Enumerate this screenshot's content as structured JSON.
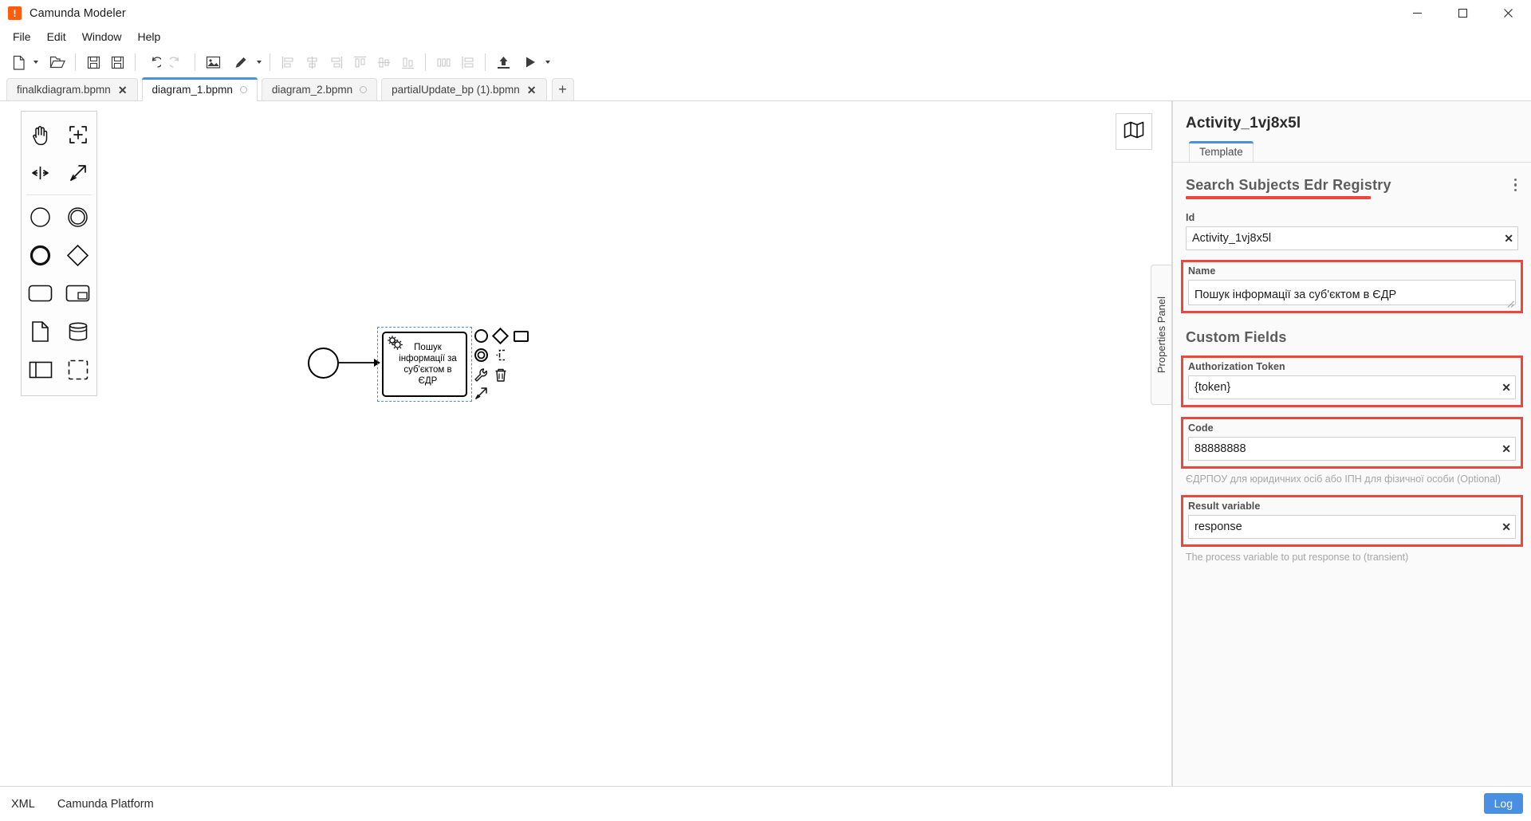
{
  "window": {
    "title": "Camunda Modeler",
    "app_icon": "camunda-icon",
    "minimize_label": "Minimize",
    "maximize_label": "Maximize",
    "close_label": "Close"
  },
  "menu": {
    "items": [
      {
        "label": "File"
      },
      {
        "label": "Edit"
      },
      {
        "label": "Window"
      },
      {
        "label": "Help"
      }
    ]
  },
  "toolbar": {
    "buttons": [
      {
        "name": "new-diagram",
        "icon": "file-icon",
        "disabled": false
      },
      {
        "name": "open-diagram",
        "icon": "folder-open-icon",
        "disabled": false
      },
      {
        "name": "save-diagram",
        "icon": "save-icon",
        "disabled": false
      },
      {
        "name": "save-as-diagram",
        "icon": "save-as-icon",
        "disabled": false
      },
      {
        "name": "undo",
        "icon": "undo-icon",
        "disabled": false
      },
      {
        "name": "redo",
        "icon": "redo-icon",
        "disabled": true
      },
      {
        "name": "export-image",
        "icon": "image-icon",
        "disabled": false
      },
      {
        "name": "set-color",
        "icon": "paintbrush-icon",
        "disabled": false
      },
      {
        "name": "align-left",
        "icon": "align-left-icon",
        "disabled": true
      },
      {
        "name": "align-center",
        "icon": "align-center-icon",
        "disabled": true
      },
      {
        "name": "align-right",
        "icon": "align-right-icon",
        "disabled": true
      },
      {
        "name": "align-top",
        "icon": "align-top-icon",
        "disabled": true
      },
      {
        "name": "align-middle",
        "icon": "align-middle-icon",
        "disabled": true
      },
      {
        "name": "align-bottom",
        "icon": "align-bottom-icon",
        "disabled": true
      },
      {
        "name": "distribute-horizontally",
        "icon": "distribute-horizontal-icon",
        "disabled": true
      },
      {
        "name": "distribute-vertically",
        "icon": "distribute-vertical-icon",
        "disabled": true
      },
      {
        "name": "deploy",
        "icon": "deploy-upload-icon",
        "disabled": false
      },
      {
        "name": "run",
        "icon": "play-icon",
        "disabled": false
      }
    ]
  },
  "tabs": {
    "items": [
      {
        "label": "finalkdiagram.bpmn",
        "active": false,
        "indicator": "close-icon"
      },
      {
        "label": "diagram_1.bpmn",
        "active": true,
        "indicator": "dot-icon"
      },
      {
        "label": "diagram_2.bpmn",
        "active": false,
        "indicator": "dot-icon"
      },
      {
        "label": "partialUpdate_bp (1).bpmn",
        "active": false,
        "indicator": "close-icon"
      }
    ],
    "add_label": "+"
  },
  "canvas": {
    "palette": [
      {
        "name": "hand-tool",
        "icon": "hand-icon"
      },
      {
        "name": "lasso-tool",
        "icon": "lasso-icon"
      },
      {
        "name": "space-tool",
        "icon": "space-tool-icon"
      },
      {
        "name": "connect-tool",
        "icon": "connect-arrow-icon"
      },
      {
        "name": "start-event",
        "icon": "circle-thin-icon"
      },
      {
        "name": "intermediate-event",
        "icon": "circle-double-icon"
      },
      {
        "name": "end-event",
        "icon": "circle-thick-icon"
      },
      {
        "name": "gateway",
        "icon": "diamond-icon"
      },
      {
        "name": "task",
        "icon": "rounded-rect-icon"
      },
      {
        "name": "subprocess-expanded",
        "icon": "subprocess-icon"
      },
      {
        "name": "data-object",
        "icon": "data-object-icon"
      },
      {
        "name": "data-store",
        "icon": "data-store-icon"
      },
      {
        "name": "participant",
        "icon": "participant-pool-icon"
      },
      {
        "name": "group",
        "icon": "group-dashed-icon"
      }
    ],
    "minimap_icon": "map-icon",
    "elements": {
      "start_event": {
        "name": "start-event-shape"
      },
      "task": {
        "name": "service-task-shape",
        "label": "Пошук інформації за суб'єктом в ЄДР",
        "type_icon": "gears-icon"
      }
    },
    "context_pad": [
      {
        "name": "append-end-event",
        "icon": "circle-thin-icon"
      },
      {
        "name": "append-gateway",
        "icon": "diamond-icon"
      },
      {
        "name": "append-task",
        "icon": "rect-icon"
      },
      {
        "name": "append-intermediate-event",
        "icon": "circle-double-icon"
      },
      {
        "name": "append-text-annotation",
        "icon": "annotation-icon"
      },
      {
        "name": "change-type",
        "icon": "wrench-icon"
      },
      {
        "name": "delete-element",
        "icon": "trash-icon"
      },
      {
        "name": "connect",
        "icon": "connect-arrow-icon"
      }
    ],
    "properties_tab_label": "Properties Panel"
  },
  "properties": {
    "title": "Activity_1vj8x5l",
    "tabs": [
      {
        "label": "Template",
        "active": true
      }
    ],
    "template": {
      "name": "Search Subjects Edr Registry",
      "menu_icon": "kebab-menu-icon",
      "fields": [
        {
          "name": "id-field",
          "label": "Id",
          "value": "Activity_1vj8x5l",
          "clear_label": "✕",
          "highlighted": false,
          "help": ""
        },
        {
          "name": "name-field",
          "label": "Name",
          "value": "Пошук інформації за суб'єктом в ЄДР",
          "clear_label": "",
          "highlighted": true,
          "help": ""
        }
      ],
      "custom_fields_title": "Custom Fields",
      "custom_fields": [
        {
          "name": "authorization-token-field",
          "label": "Authorization Token",
          "value": "{token}",
          "clear_label": "✕",
          "highlighted": true,
          "help": ""
        },
        {
          "name": "code-field",
          "label": "Code",
          "value": "88888888",
          "clear_label": "✕",
          "highlighted": true,
          "help": "ЄДРПОУ для юридичних осіб або ІПН для фізичної особи (Optional)"
        },
        {
          "name": "result-variable-field",
          "label": "Result variable",
          "value": "response",
          "clear_label": "✕",
          "highlighted": true,
          "help": "The process variable to put response to (transient)"
        }
      ]
    }
  },
  "statusbar": {
    "items": [
      {
        "label": "XML",
        "name": "xml-view-button"
      },
      {
        "label": "Camunda Platform",
        "name": "engine-profile-button"
      }
    ],
    "log_label": "Log"
  },
  "colors": {
    "accent": "#4a90e2",
    "highlight": "#f0453a",
    "brand": "#fc5d0d"
  }
}
